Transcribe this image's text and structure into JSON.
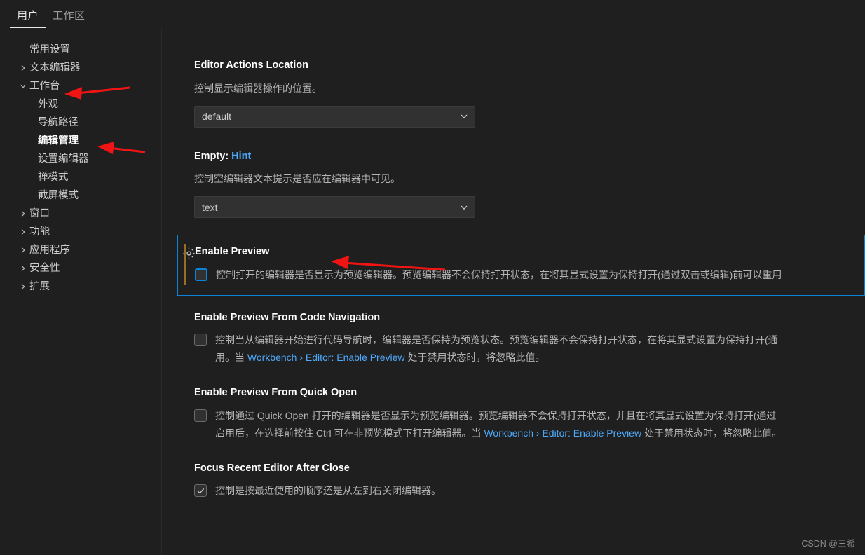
{
  "tabs": [
    {
      "label": "用户",
      "active": true
    },
    {
      "label": "工作区",
      "active": false
    }
  ],
  "toc": [
    {
      "label": "常用设置",
      "level": 0,
      "twisty": "none",
      "selected": false
    },
    {
      "label": "文本编辑器",
      "level": 0,
      "twisty": "collapsed",
      "selected": false
    },
    {
      "label": "工作台",
      "level": 0,
      "twisty": "expanded",
      "selected": false
    },
    {
      "label": "外观",
      "level": 1,
      "twisty": "none",
      "selected": false
    },
    {
      "label": "导航路径",
      "level": 1,
      "twisty": "none",
      "selected": false
    },
    {
      "label": "编辑管理",
      "level": 1,
      "twisty": "none",
      "selected": true
    },
    {
      "label": "设置编辑器",
      "level": 1,
      "twisty": "none",
      "selected": false
    },
    {
      "label": "禅模式",
      "level": 1,
      "twisty": "none",
      "selected": false
    },
    {
      "label": "截屏模式",
      "level": 1,
      "twisty": "none",
      "selected": false
    },
    {
      "label": "窗口",
      "level": 0,
      "twisty": "collapsed",
      "selected": false
    },
    {
      "label": "功能",
      "level": 0,
      "twisty": "collapsed",
      "selected": false
    },
    {
      "label": "应用程序",
      "level": 0,
      "twisty": "collapsed",
      "selected": false
    },
    {
      "label": "安全性",
      "level": 0,
      "twisty": "collapsed",
      "selected": false
    },
    {
      "label": "扩展",
      "level": 0,
      "twisty": "collapsed",
      "selected": false
    }
  ],
  "settings": {
    "editor_actions_location": {
      "title": "Editor Actions Location",
      "description": "控制显示编辑器操作的位置。",
      "value": "default"
    },
    "empty_hint": {
      "title_prefix": "Empty: ",
      "title_accent": "Hint",
      "description": "控制空编辑器文本提示是否应在编辑器中可见。",
      "value": "text"
    },
    "enable_preview": {
      "title": "Enable Preview",
      "description": "控制打开的编辑器是否显示为预览编辑器。预览编辑器不会保持打开状态，在将其显式设置为保持打开(通过双击或编辑)前可以重用",
      "checked": false,
      "modified": true,
      "focused": true
    },
    "enable_preview_from_code_navigation": {
      "title": "Enable Preview From Code Navigation",
      "desc_line1": "控制当从编辑器开始进行代码导航时，编辑器是否保持为预览状态。预览编辑器不会保持打开状态，在将其显式设置为保持打开(通",
      "desc_line2_pre": "用。当 ",
      "desc_link": "Workbench › Editor: Enable Preview",
      "desc_line2_post": " 处于禁用状态时，将忽略此值。",
      "checked": false
    },
    "enable_preview_from_quick_open": {
      "title": "Enable Preview From Quick Open",
      "desc_line1": "控制通过 Quick Open 打开的编辑器是否显示为预览编辑器。预览编辑器不会保持打开状态，并且在将其显式设置为保持打开(通过",
      "desc_line2_pre": "启用后，在选择前按住 Ctrl 可在非预览模式下打开编辑器。当 ",
      "desc_link": "Workbench › Editor: Enable Preview",
      "desc_line2_post": " 处于禁用状态时，将忽略此值。",
      "checked": false
    },
    "focus_recent_editor_after_close": {
      "title": "Focus Recent Editor After Close",
      "description": "控制是按最近使用的顺序还是从左到右关闭编辑器。",
      "checked": true
    }
  },
  "annotations": {
    "arrow_color": "#f01414",
    "arrows": [
      {
        "name": "arrow-to-workbench",
        "target": "工作台"
      },
      {
        "name": "arrow-to-edit-management",
        "target": "编辑管理"
      },
      {
        "name": "arrow-to-enable-preview",
        "target": "Enable Preview"
      }
    ]
  },
  "watermark": "CSDN @三希",
  "colors": {
    "background": "#1f1f1f",
    "focus_border": "#0a84d8",
    "modified_indicator": "#9a6d21",
    "link": "#4daafc",
    "title": "#ffffff",
    "description": "#b4b4b4"
  }
}
